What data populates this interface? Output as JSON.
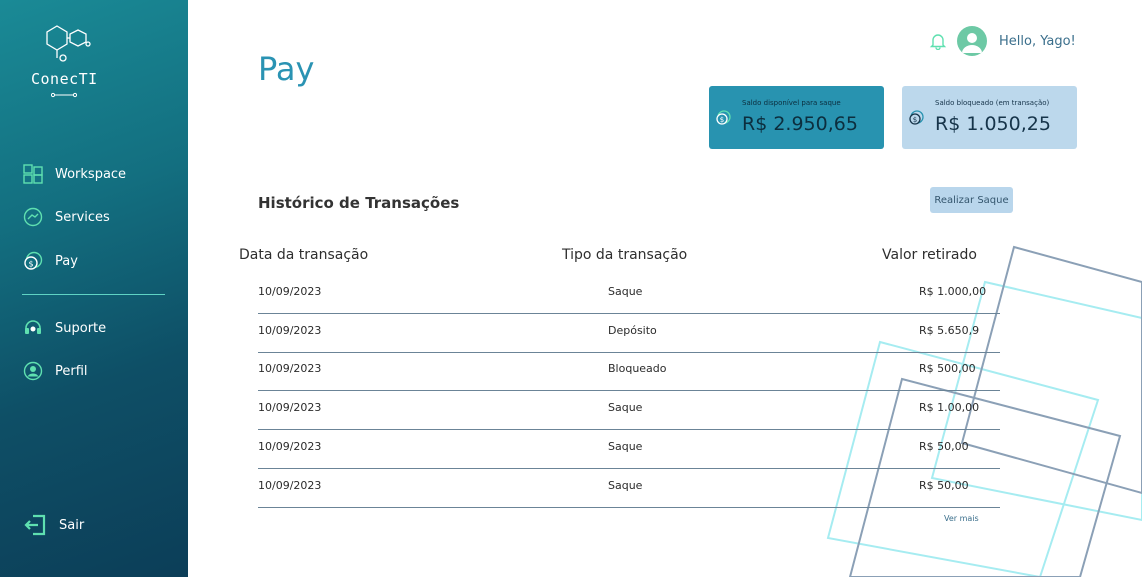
{
  "brand": {
    "name": "ConecTI"
  },
  "sidebar": {
    "items": [
      {
        "label": "Workspace",
        "icon": "workspace-icon"
      },
      {
        "label": "Services",
        "icon": "services-icon"
      },
      {
        "label": "Pay",
        "icon": "pay-icon"
      },
      {
        "label": "Suporte",
        "icon": "headset-icon"
      },
      {
        "label": "Perfil",
        "icon": "profile-icon"
      }
    ],
    "logout_label": "Sair"
  },
  "header": {
    "title": "Pay",
    "greeting": "Hello, Yago!"
  },
  "balances": {
    "available": {
      "label": "Saldo disponível para saque",
      "value": "R$ 2.950,65"
    },
    "blocked": {
      "label": "Saldo bloqueado (em transação)",
      "value": "R$ 1.050,25"
    }
  },
  "history": {
    "title": "Histórico de Transações",
    "withdraw_label": "Realizar Saque",
    "columns": [
      "Data da transação",
      "Tipo da transação",
      "Valor retirado"
    ],
    "rows": [
      {
        "date": "10/09/2023",
        "type": "Saque",
        "amount": "R$ 1.000,00"
      },
      {
        "date": "10/09/2023",
        "type": "Depósito",
        "amount": "R$ 5.650,9"
      },
      {
        "date": "10/09/2023",
        "type": "Bloqueado",
        "amount": "R$ 500,00"
      },
      {
        "date": "10/09/2023",
        "type": "Saque",
        "amount": "R$ 1.00,00"
      },
      {
        "date": "10/09/2023",
        "type": "Saque",
        "amount": "R$ 50,00"
      },
      {
        "date": "10/09/2023",
        "type": "Saque",
        "amount": "R$ 50,00"
      }
    ],
    "see_more": "Ver mais"
  },
  "colors": {
    "sidebar_top": "#1a8a96",
    "sidebar_bottom": "#0c3e58",
    "accent": "#2a93b3",
    "icon_green": "#5fe0b0",
    "card_available": "#2893b0",
    "card_blocked": "#bcd8ec"
  }
}
